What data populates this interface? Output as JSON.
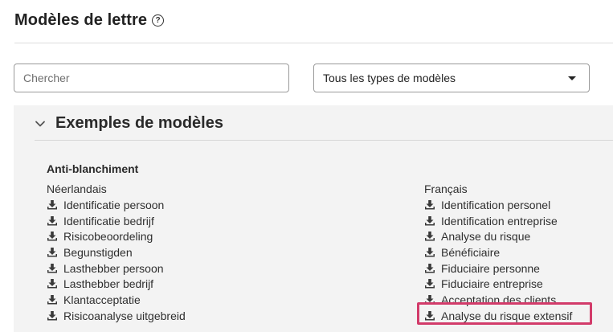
{
  "header": {
    "title": "Modèles de lettre",
    "help_icon": "help-circle-icon"
  },
  "filters": {
    "search_placeholder": "Chercher",
    "search_value": "",
    "type_select_value": "Tous les types de modèles"
  },
  "panel": {
    "title": "Exemples de modèles",
    "expanded": true,
    "category": "Anti-blanchiment",
    "nl": {
      "language": "Néerlandais",
      "items": [
        "Identificatie persoon",
        "Identificatie bedrijf",
        "Risicobeoordeling",
        "Begunstigden",
        "Lasthebber persoon",
        "Lasthebber bedrijf",
        "Klantacceptatie",
        "Risicoanalyse uitgebreid"
      ]
    },
    "fr": {
      "language": "Français",
      "items": [
        "Identification personel",
        "Identification entreprise",
        "Analyse du risque",
        "Bénéficiaire",
        "Fiduciaire personne",
        "Fiduciaire entreprise",
        "Acceptation des clients",
        "Analyse du risque extensif"
      ],
      "highlighted_item": "Analyse du risque extensif"
    }
  },
  "colors": {
    "highlight": "#d23b6a",
    "panel_bg": "#f3f3f3",
    "text": "#2f2f2f"
  }
}
